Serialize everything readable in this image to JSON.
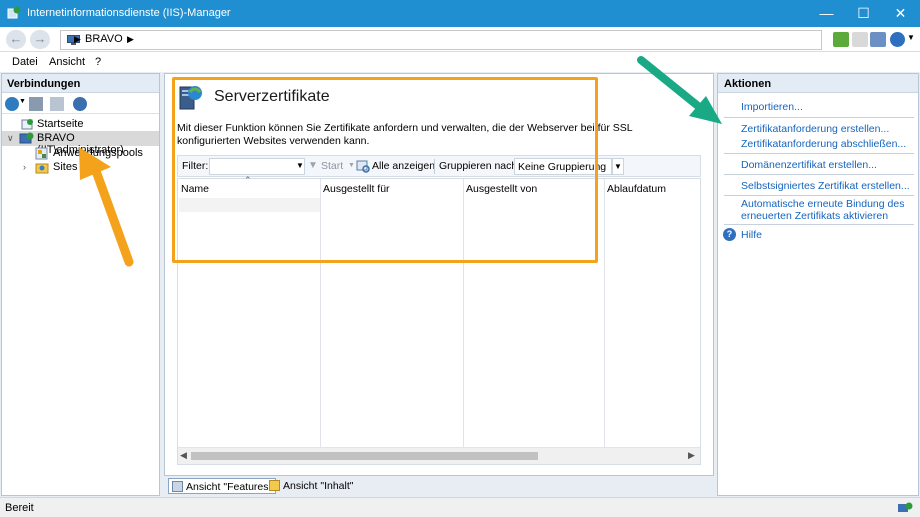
{
  "window": {
    "title": "Internetinformationsdienste (IIS)-Manager"
  },
  "address": {
    "segment": "BRAVO"
  },
  "menu": {
    "items": [
      "Datei",
      "Ansicht",
      "?"
    ]
  },
  "connections": {
    "header": "Verbindungen",
    "tree": {
      "start": "Startseite",
      "server": "BRAVO (IIT\\administrator)",
      "apppools": "Anwendungspools",
      "sites": "Sites"
    }
  },
  "content": {
    "title": "Serverzertifikate",
    "description": "Mit dieser Funktion können Sie Zertifikate anfordern und verwalten, die der Webserver bei für SSL konfigurierten Websites verwenden kann.",
    "filter_label": "Filter:",
    "filter_value": "",
    "start_label": "Start",
    "show_all_label": "Alle anzeigen",
    "group_by_label": "Gruppieren nach:",
    "group_by_value": "Keine Gruppierung",
    "columns": [
      "Name",
      "Ausgestellt für",
      "Ausgestellt von",
      "Ablaufdatum"
    ],
    "view_features": "Ansicht \"Features\"",
    "view_content": "Ansicht \"Inhalt\""
  },
  "actions": {
    "header": "Aktionen",
    "items": [
      "Importieren...",
      "Zertifikatanforderung erstellen...",
      "Zertifikatanforderung abschließen...",
      "Domänenzertifikat erstellen...",
      "Selbstsigniertes Zertifikat erstellen...",
      "Automatische erneute Bindung des",
      "erneuerten Zertifikats aktivieren",
      "Hilfe"
    ]
  },
  "status": {
    "text": "Bereit"
  },
  "colors": {
    "titlebar": "#1f8fd1",
    "link": "#1565c0",
    "highlight_frame": "#f4a21c",
    "arrow_orange": "#f4a21c",
    "arrow_green": "#1aa985"
  }
}
